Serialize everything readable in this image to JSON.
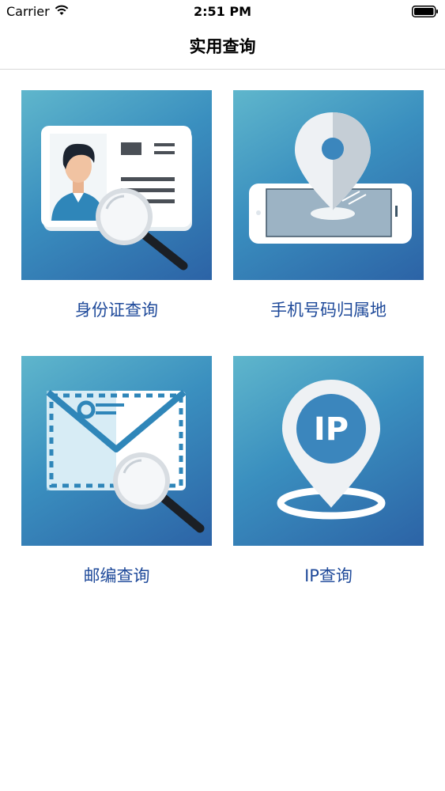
{
  "status_bar": {
    "carrier": "Carrier",
    "time": "2:51 PM"
  },
  "nav": {
    "title": "实用查询"
  },
  "tiles": [
    {
      "label": "身份证查询",
      "icon": "id-card-search-icon"
    },
    {
      "label": "手机号码归属地",
      "icon": "phone-location-icon"
    },
    {
      "label": "邮编查询",
      "icon": "envelope-search-icon"
    },
    {
      "label": "IP查询",
      "icon": "ip-location-icon",
      "badge": "IP"
    }
  ]
}
